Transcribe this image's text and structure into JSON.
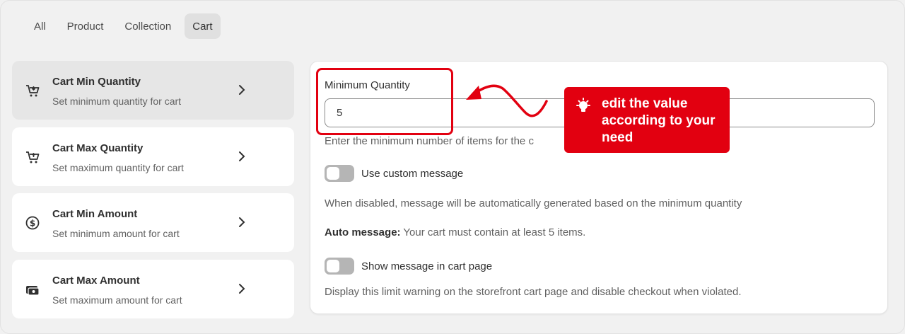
{
  "tabs": [
    {
      "label": "All"
    },
    {
      "label": "Product"
    },
    {
      "label": "Collection"
    },
    {
      "label": "Cart",
      "active": true
    }
  ],
  "menu": {
    "items": [
      {
        "title": "Cart Min Quantity",
        "subtitle": "Set minimum quantity for cart",
        "icon": "cart-down-icon",
        "active": true
      },
      {
        "title": "Cart Max Quantity",
        "subtitle": "Set maximum quantity for cart",
        "icon": "cart-up-icon"
      },
      {
        "title": "Cart Min Amount",
        "subtitle": "Set minimum amount for cart",
        "icon": "dollar-circle-icon"
      },
      {
        "title": "Cart Max Amount",
        "subtitle": "Set maximum amount for cart",
        "icon": "cash-stack-icon"
      }
    ]
  },
  "panel": {
    "field_label": "Minimum Quantity",
    "field_value": "5",
    "help_text": "Enter the minimum number of items for the c",
    "custom_message_label": "Use custom message",
    "custom_message_on": false,
    "disabled_note": "When disabled, message will be automatically generated based on the minimum quantity",
    "auto_message_label": "Auto message:",
    "auto_message_text": " Your cart must contain at least 5 items.",
    "cart_page_label": "Show message in cart page",
    "cart_page_on": false,
    "cart_page_note": "Display this limit warning on the storefront cart page and disable checkout when violated."
  },
  "annotation": {
    "text": "edit the value according to your need",
    "color": "#e20010",
    "icon": "lightbulb-icon"
  }
}
